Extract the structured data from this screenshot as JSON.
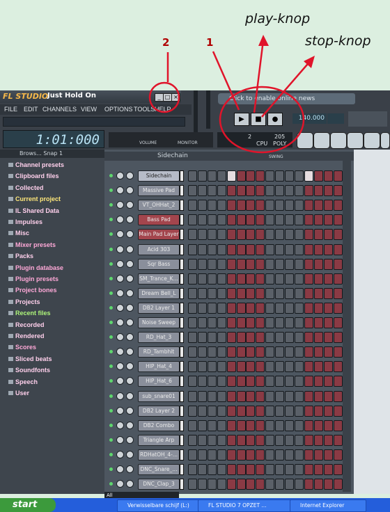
{
  "annotations": {
    "play_label": "play-knop",
    "stop_label": "stop-knop",
    "marker_2": "2",
    "marker_1": "1"
  },
  "app": {
    "logo": "FL STUDIO",
    "song_title": "Just Hold On",
    "menu": [
      "FILE",
      "EDIT",
      "CHANNELS",
      "VIEW",
      "OPTIONS",
      "TOOLS",
      "HELP"
    ],
    "time": "1:01:000",
    "news": "Click to enable online news",
    "tempo": "140.000",
    "cpu_value": "205",
    "cpu_label": "CPU",
    "poly_label": "POLY",
    "voices": "2",
    "volume_label": "VOLUME",
    "monitor_label": "MONITOR"
  },
  "browser": {
    "header": "Brows... Snap 1",
    "items": [
      {
        "label": "Channel presets",
        "color": "#ffd0ec"
      },
      {
        "label": "Clipboard files",
        "color": "#ffd0ec"
      },
      {
        "label": "Collected",
        "color": "#ffd0ec"
      },
      {
        "label": "Current project",
        "color": "#ffe87a"
      },
      {
        "label": "IL Shared Data",
        "color": "#ffd0ec"
      },
      {
        "label": "Impulses",
        "color": "#ffd0ec"
      },
      {
        "label": "Misc",
        "color": "#ffd0ec"
      },
      {
        "label": "Mixer presets",
        "color": "#ffa9d8"
      },
      {
        "label": "Packs",
        "color": "#ffd0ec"
      },
      {
        "label": "Plugin database",
        "color": "#ffa9d8"
      },
      {
        "label": "Plugin presets",
        "color": "#ffa9d8"
      },
      {
        "label": "Project bones",
        "color": "#ffa9d8"
      },
      {
        "label": "Projects",
        "color": "#ffd0ec"
      },
      {
        "label": "Recent files",
        "color": "#aef57a"
      },
      {
        "label": "Recorded",
        "color": "#ffd0ec"
      },
      {
        "label": "Rendered",
        "color": "#ffd0ec"
      },
      {
        "label": "Scores",
        "color": "#ffa9d8"
      },
      {
        "label": "Sliced beats",
        "color": "#ffd0ec"
      },
      {
        "label": "Soundfonts",
        "color": "#ffd0ec"
      },
      {
        "label": "Speech",
        "color": "#ffd0ec"
      },
      {
        "label": "User",
        "color": "#ffd0ec"
      }
    ]
  },
  "step_sequencer": {
    "title": "Sidechain",
    "swing_label": "SWING",
    "filter": "All",
    "channels": [
      "Sidechain",
      "Massive Pad",
      "VT_OHHat_2",
      "Bass Pad",
      "Main Pad Layer",
      "Acid 303",
      "Sqr Bass",
      "SM_Trance_K...",
      "Dream Bell_L",
      "DB2 Layer 1",
      "Noise Sweep",
      "RD_Hat_3",
      "RD_Tambhit",
      "HIP_Hat_4",
      "HIP_Hat_6",
      "sub_snare01",
      "DB2 Layer 2",
      "DB2 Combo",
      "Triangle Arp",
      "RDHatOH_4-...",
      "DNC_Snare_...",
      "DNC_Clap_3"
    ]
  },
  "taskbar": {
    "start": "start",
    "tasks": [
      "Verwisselbare schijf (L:)",
      "FL STUDIO 7 OPZET ...",
      "Internet Explorer"
    ]
  }
}
